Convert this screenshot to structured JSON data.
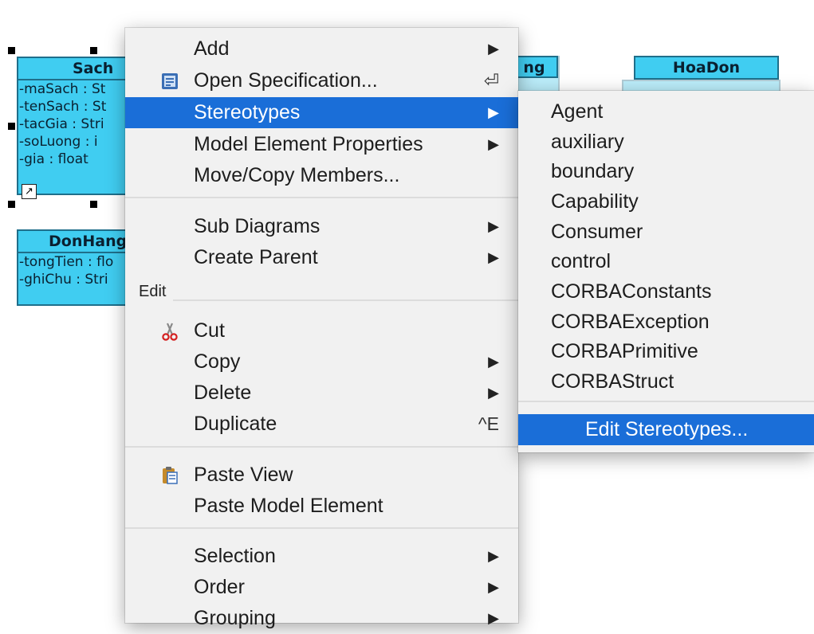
{
  "diagram": {
    "classes": [
      {
        "name": "Sach",
        "attributes": [
          "-maSach : St",
          "-tenSach : St",
          "-tacGia : Stri",
          "-soLuong : i",
          "-gia : float"
        ]
      },
      {
        "name": "DonHang",
        "attributes": [
          "-tongTien : flo",
          "-ghiChu : Stri"
        ]
      },
      {
        "name": "HoaDon",
        "attributes": []
      },
      {
        "name": "ng",
        "attributes": []
      }
    ],
    "link_mark": "↗"
  },
  "context_menu": {
    "group_label": "Edit",
    "items": [
      {
        "label": "Add",
        "arrow": "▶"
      },
      {
        "label": "Open Specification...",
        "shortcut": "⏎"
      },
      {
        "label": "Stereotypes",
        "arrow": "▶"
      },
      {
        "label": "Model Element Properties",
        "arrow": "▶"
      },
      {
        "label": "Move/Copy Members..."
      },
      {
        "label": "Sub Diagrams",
        "arrow": "▶"
      },
      {
        "label": "Create Parent",
        "arrow": "▶"
      },
      {
        "label": "Cut"
      },
      {
        "label": "Copy",
        "arrow": "▶"
      },
      {
        "label": "Delete",
        "arrow": "▶"
      },
      {
        "label": "Duplicate",
        "shortcut": "^E"
      },
      {
        "label": "Paste View"
      },
      {
        "label": "Paste Model Element"
      },
      {
        "label": "Selection",
        "arrow": "▶"
      },
      {
        "label": "Order",
        "arrow": "▶"
      },
      {
        "label": "Grouping",
        "arrow": "▶"
      }
    ]
  },
  "stereotypes_submenu": {
    "items": [
      "Agent",
      "auxiliary",
      "boundary",
      "Capability",
      "Consumer",
      "control",
      "CORBAConstants",
      "CORBAException",
      "CORBAPrimitive",
      "CORBAStruct"
    ],
    "edit_label": "Edit Stereotypes..."
  },
  "colors": {
    "class_fill": "#40cdf1",
    "class_border": "#1f6f8b",
    "menu_bg": "#f1f1f1",
    "highlight": "#1a6ed8"
  }
}
